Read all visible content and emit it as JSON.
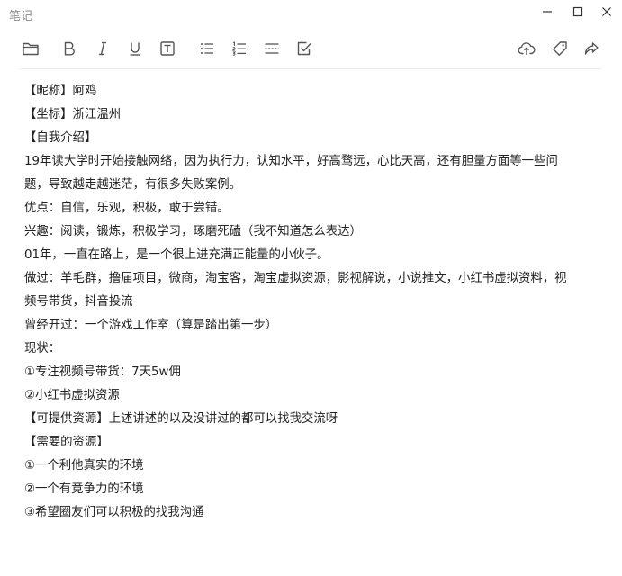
{
  "window": {
    "title": "笔记",
    "controls": {
      "minimize_icon": "minimize-icon",
      "maximize_icon": "maximize-icon",
      "close_icon": "close-icon"
    }
  },
  "toolbar": {
    "left_icons": [
      "folder-icon",
      "bold-icon",
      "italic-icon",
      "underline-icon",
      "text-box-icon",
      "bullet-list-icon",
      "numbered-list-icon",
      "divider-line-icon",
      "checkbox-icon"
    ],
    "right_icons": [
      "cloud-upload-icon",
      "tag-icon",
      "share-icon"
    ],
    "icon_color": "#555555"
  },
  "note": {
    "lines": [
      "【昵称】阿鸡",
      "【坐标】浙江温州",
      "【自我介绍】",
      "19年读大学时开始接触网络，因为执行力，认知水平，好高骛远，心比天高，还有胆量方面等一些问",
      "题，导致越走越迷茫，有很多失败案例。",
      "优点：自信，乐观，积极，敢于尝错。",
      "兴趣：阅读，锻炼，积极学习，琢磨死磕（我不知道怎么表达）",
      "01年，一直在路上，是一个很上进充满正能量的小伙子。",
      "做过：羊毛群，撸届项目，微商，淘宝客，淘宝虚拟资源，影视解说，小说推文，小红书虚拟资料，视",
      "频号带货，抖音投流",
      "曾经开过：一个游戏工作室（算是踏出第一步）",
      "现状：",
      "①专注视频号带货：7天5w佣",
      "②小红书虚拟资源",
      "【可提供资源】上述讲述的以及没讲过的都可以找我交流呀",
      "【需要的资源】",
      "①一个利他真实的环境",
      "②一个有竞争力的环境",
      "③希望圈友们可以积极的找我沟通"
    ]
  }
}
